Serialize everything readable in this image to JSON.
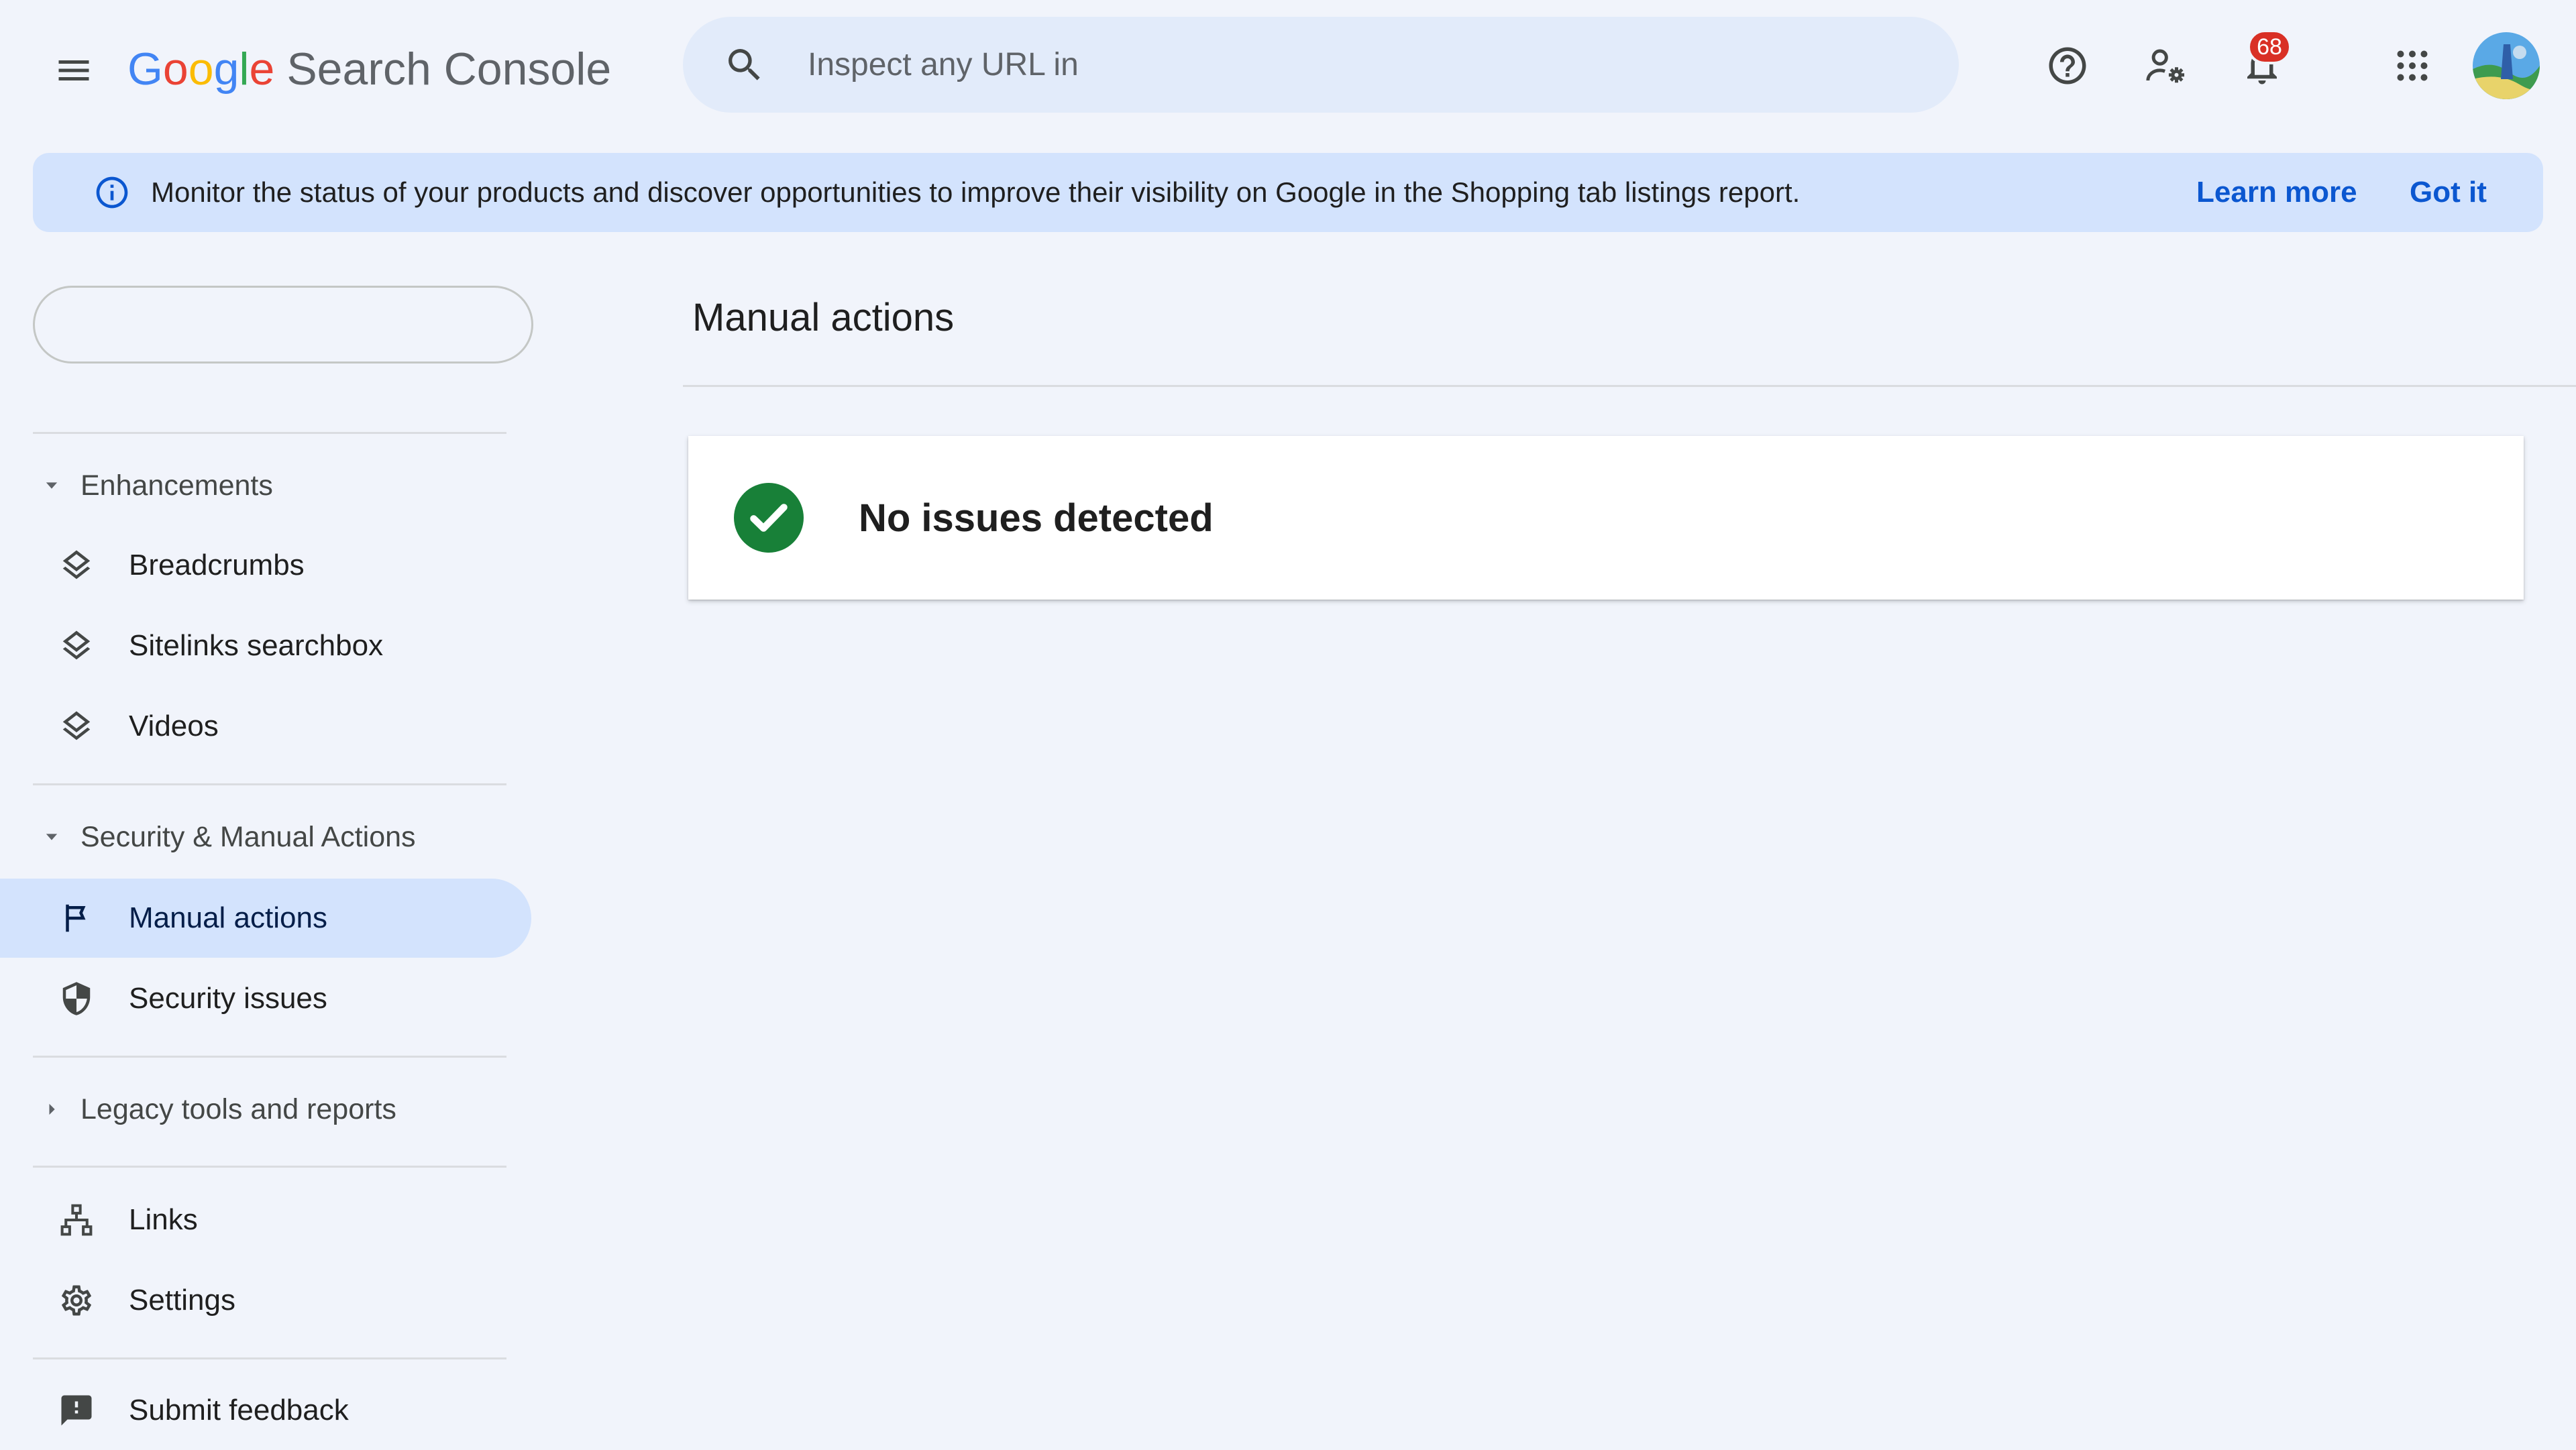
{
  "header": {
    "menu_icon": "hamburger-menu-icon",
    "logo": {
      "g1": "G",
      "o1": "o",
      "o2": "o",
      "g2": "g",
      "l": "l",
      "e": "e",
      "product": "Search Console"
    },
    "search_placeholder": "Inspect any URL in",
    "notification_count": "68",
    "icons": [
      "help-icon",
      "admin-settings-icon",
      "notifications-bell-icon",
      "apps-grid-icon"
    ]
  },
  "banner": {
    "message": "Monitor the status of your products and discover opportunities to improve their visibility on Google in the Shopping tab listings report.",
    "learn_more": "Learn more",
    "got_it": "Got it"
  },
  "sidebar": {
    "enhancements": {
      "label": "Enhancements",
      "items": [
        {
          "label": "Breadcrumbs",
          "icon": "layers-icon"
        },
        {
          "label": "Sitelinks searchbox",
          "icon": "layers-icon"
        },
        {
          "label": "Videos",
          "icon": "layers-icon"
        }
      ]
    },
    "security": {
      "label": "Security & Manual Actions",
      "items": [
        {
          "label": "Manual actions",
          "icon": "flag-icon",
          "active": true
        },
        {
          "label": "Security issues",
          "icon": "shield-icon"
        }
      ]
    },
    "legacy": {
      "label": "Legacy tools and reports"
    },
    "bottom_items": [
      {
        "label": "Links",
        "icon": "sitemap-icon"
      },
      {
        "label": "Settings",
        "icon": "gear-icon"
      }
    ],
    "feedback": {
      "label": "Submit feedback",
      "icon": "feedback-icon"
    }
  },
  "main": {
    "title": "Manual actions",
    "result": "No issues detected"
  },
  "colors": {
    "background": "#f1f4fb",
    "accent": "#0b57d0",
    "active_nav": "#d3e3fd",
    "success": "#188038",
    "badge": "#d93025"
  }
}
